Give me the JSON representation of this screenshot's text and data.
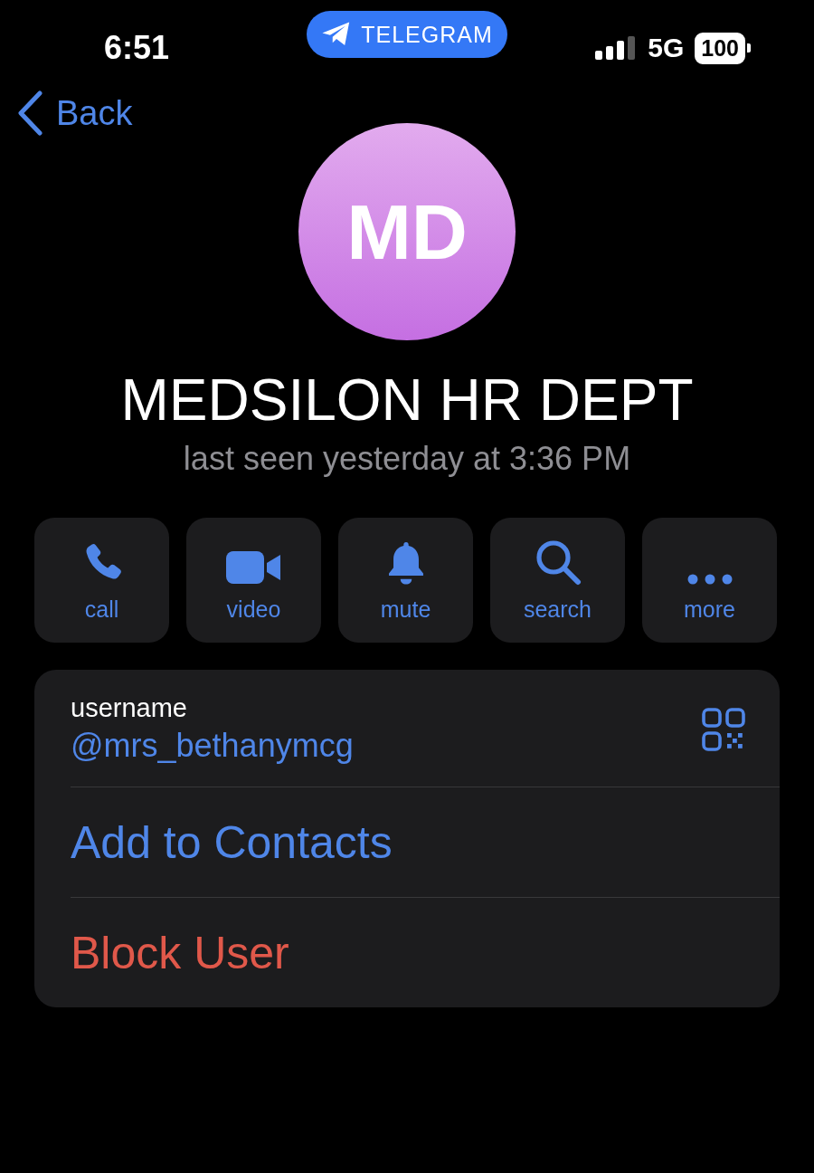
{
  "status_bar": {
    "time": "6:51",
    "app_pill": "TELEGRAM",
    "network": "5G",
    "battery": "100"
  },
  "nav": {
    "back": "Back"
  },
  "profile": {
    "initials": "MD",
    "name": "MEDSILON HR DEPT",
    "status": "last seen yesterday at 3:36 PM"
  },
  "actions": [
    {
      "kind": "call",
      "label": "call"
    },
    {
      "kind": "video",
      "label": "video"
    },
    {
      "kind": "mute",
      "label": "mute"
    },
    {
      "kind": "search",
      "label": "search"
    },
    {
      "kind": "more",
      "label": "more"
    }
  ],
  "info": {
    "username_label": "username",
    "username": "@mrs_bethanymcg"
  },
  "menu": [
    {
      "kind": "normal",
      "label": "Add to Contacts"
    },
    {
      "kind": "destructive",
      "label": "Block User"
    }
  ]
}
